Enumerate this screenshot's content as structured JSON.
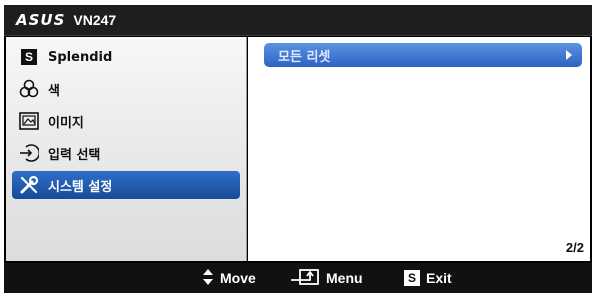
{
  "header": {
    "brand": "ASUS",
    "model": "VN247"
  },
  "sidebar": {
    "items": [
      {
        "label": "Splendid",
        "icon": "splendid-s-icon",
        "active": false
      },
      {
        "label": "색",
        "icon": "color-rgb-icon",
        "active": false
      },
      {
        "label": "이미지",
        "icon": "image-icon",
        "active": false
      },
      {
        "label": "입력 선택",
        "icon": "input-select-icon",
        "active": false
      },
      {
        "label": "시스템 설정",
        "icon": "wrench-screwdriver-icon",
        "active": true
      }
    ]
  },
  "content": {
    "options": [
      {
        "label": "모든 리셋",
        "icon": "chevron-right-icon"
      }
    ],
    "page_indicator": "2/2"
  },
  "footer": {
    "move_label": "Move",
    "menu_label": "Menu",
    "exit_label": "Exit",
    "exit_key": "S"
  },
  "colors": {
    "accent": "#1f56a8",
    "option_highlight": "#3f78d4",
    "background": "#000000"
  }
}
